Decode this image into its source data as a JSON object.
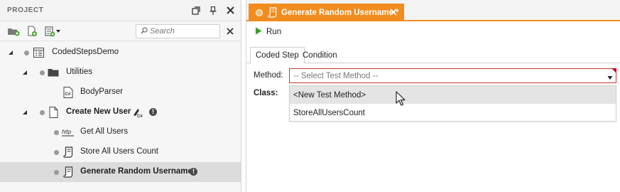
{
  "project": {
    "title": "PROJECT",
    "search_placeholder": "Search",
    "tree": [
      {
        "label": "CodedStepsDemo",
        "bold": false,
        "icon": "test-list-icon"
      },
      {
        "label": "Utilities",
        "bold": false,
        "icon": "folder-icon"
      },
      {
        "label": "BodyParser",
        "bold": false,
        "icon": "csharp-file-icon"
      },
      {
        "label": "Create New User",
        "bold": true,
        "icon": "file-icon",
        "badges": [
          "csharp-badge-icon",
          "info-icon"
        ]
      },
      {
        "label": "Get All Users",
        "bold": false,
        "icon": "http-icon"
      },
      {
        "label": "Store All Users Count",
        "bold": false,
        "icon": "script-icon"
      },
      {
        "label": "Generate Random Username",
        "bold": true,
        "icon": "script-icon",
        "selected": true,
        "badges": [
          "info-icon"
        ]
      }
    ]
  },
  "editor": {
    "tab_label": "Generate Random Username *",
    "run_label": "Run",
    "subtabs": [
      "Coded Step",
      "Condition"
    ],
    "method_label": "Method:",
    "method_placeholder": "-- Select Test Method --",
    "class_label": "Class:",
    "dropdown_options": [
      "<New Test Method>",
      "StoreAllUsersCount"
    ]
  },
  "colors": {
    "accent": "#f28c1e",
    "error": "#c0392b",
    "run_green": "#3a9d23",
    "selected_row": "#dcdcdc"
  }
}
